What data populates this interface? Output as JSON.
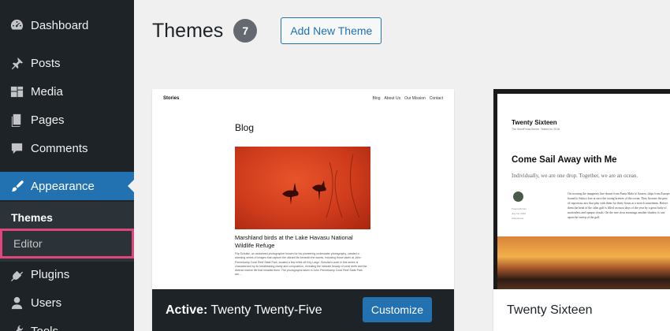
{
  "sidebar": {
    "items": [
      {
        "label": "Dashboard",
        "icon": "dashboard-icon"
      },
      {
        "label": "Posts",
        "icon": "pin-icon"
      },
      {
        "label": "Media",
        "icon": "media-icon"
      },
      {
        "label": "Pages",
        "icon": "pages-icon"
      },
      {
        "label": "Comments",
        "icon": "comments-icon"
      },
      {
        "label": "Appearance",
        "icon": "paintbrush-icon",
        "active": true
      },
      {
        "label": "Plugins",
        "icon": "plug-icon"
      },
      {
        "label": "Users",
        "icon": "users-icon"
      },
      {
        "label": "Tools",
        "icon": "wrench-icon"
      }
    ],
    "submenu": [
      {
        "label": "Themes",
        "current": true
      },
      {
        "label": "Editor",
        "highlighted": true
      }
    ]
  },
  "header": {
    "title": "Themes",
    "count": "7",
    "add_new_label": "Add New Theme"
  },
  "themes": {
    "active": {
      "prefix": "Active:",
      "name": "Twenty Twenty-Five",
      "customize_label": "Customize",
      "preview": {
        "site_title": "Stories",
        "nav": [
          "Blog",
          "About Us",
          "Our Mission",
          "Contact"
        ],
        "heading": "Blog",
        "caption": "Marshland birds at the Lake Havasu National Wildlife Refuge",
        "body": "Flip Schulke, an acclaimed photographer known for his pioneering underwater photography, created a stunning series of images that capture the vibrant life beneath the waves, including those taken at John Pennekamp Coral Reef State Park, located a few miles off Key Largo. Schulke's work in this series is characterized by its breathtaking clarity and composition, revealing the intricate beauty of coral reefs and the diverse marine life that inhabits them. The photographs taken in John Pennekamp Coral Reef State Park are..."
      }
    },
    "second": {
      "name": "Twenty Sixteen",
      "preview": {
        "site_name": "Twenty Sixteen",
        "tagline": "The WordPress theme. Tested for 2016",
        "post_title": "Come Sail Away with Me",
        "excerpt": "Individually, we are one drop. Together, we are an ocean.",
        "meta": [
          "Twenty16 Fan",
          "July 19, 2016",
          "Adventures"
        ],
        "text": "On crossing the imaginary line drawn from Punta Mala to Azuera, ships from Europe bound to Sulaco lose at once the strong breezes of the ocean. They become the prey of capricious airs that play with them for thirty hours at a stretch sometimes. Before them the head of the calm gulf is filled on most days of the year by a great body of motionless and opaque clouds. On the rare clear mornings another shadow is cast upon the sweep of the gulf."
      }
    }
  }
}
